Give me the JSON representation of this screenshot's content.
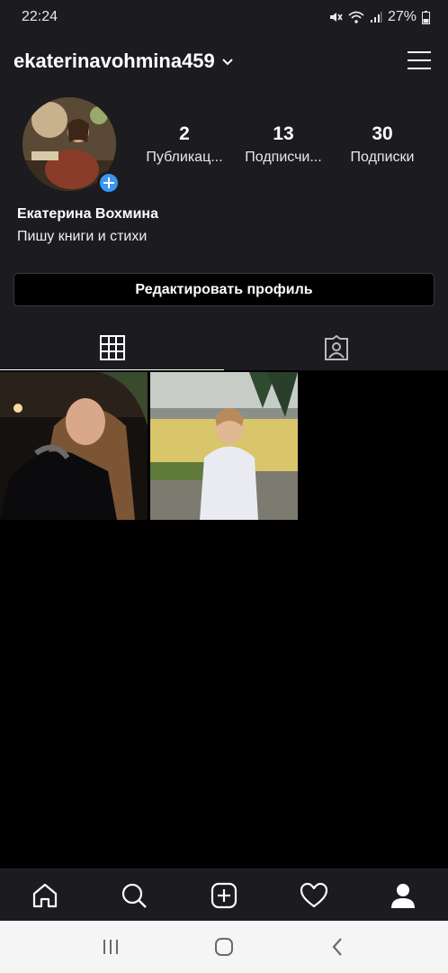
{
  "status_bar": {
    "time": "22:24",
    "battery": "27%"
  },
  "header": {
    "username": "ekaterinavohmina459",
    "dropdown_icon": "chevron-down-icon",
    "menu_icon": "hamburger-menu-icon"
  },
  "profile": {
    "stats": [
      {
        "value": "2",
        "label": "Публикац..."
      },
      {
        "value": "13",
        "label": "Подписчи..."
      },
      {
        "value": "30",
        "label": "Подписки"
      }
    ],
    "full_name": "Екатерина Вохмина",
    "bio": "Пишу книги и стихи",
    "edit_button": "Редактировать профиль"
  },
  "tabs": [
    {
      "icon": "grid-icon",
      "active": true
    },
    {
      "icon": "tagged-user-icon",
      "active": false
    }
  ],
  "colors": {
    "background": "#000000",
    "panel": "#1c1b20",
    "accent": "#3897f0",
    "system_nav": "#f5f5f5"
  },
  "bottom_nav": [
    "home-icon",
    "search-icon",
    "add-post-icon",
    "heart-icon",
    "profile-icon"
  ],
  "system_nav": [
    "recent-apps-icon",
    "home-circle-icon",
    "back-icon"
  ]
}
